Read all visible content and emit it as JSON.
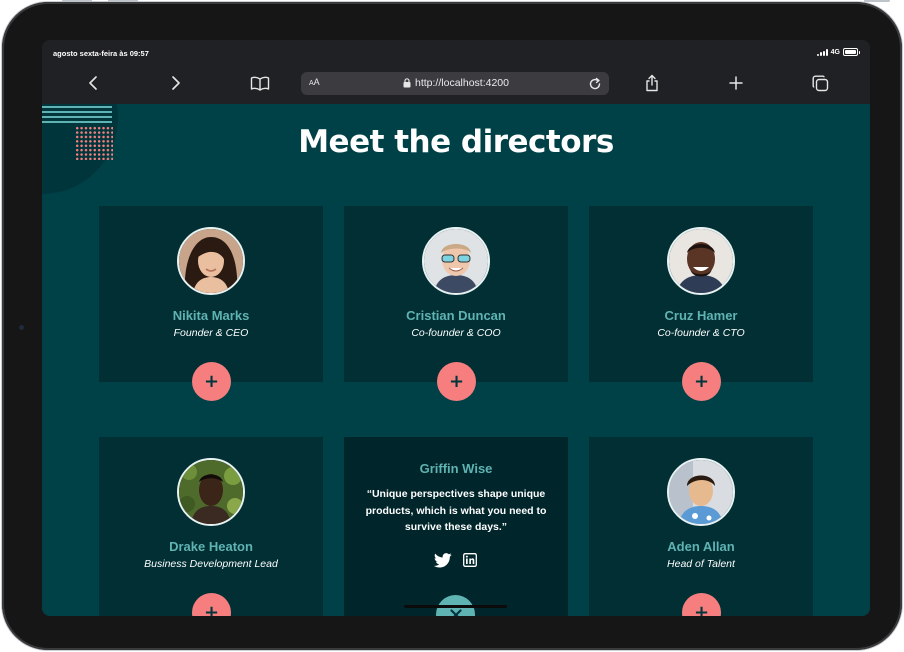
{
  "status_bar": {
    "time": "agosto sexta-feira às 09:57",
    "network": "4G"
  },
  "browser": {
    "text_size_label": "AA",
    "url": "http://localhost:4200"
  },
  "page": {
    "title": "Meet the directors"
  },
  "directors": [
    {
      "name": "Nikita Marks",
      "role": "Founder & CEO"
    },
    {
      "name": "Cristian Duncan",
      "role": "Co-founder & COO"
    },
    {
      "name": "Cruz Hamer",
      "role": "Co-founder & CTO"
    },
    {
      "name": "Drake Heaton",
      "role": "Business Development Lead"
    },
    {
      "name": "Griffin Wise",
      "quote": "“Unique perspectives shape unique products, which is what you need to survive these days.”"
    },
    {
      "name": "Aden Allan",
      "role": "Head of Talent"
    }
  ],
  "buttons": {
    "expand_label": "+"
  },
  "colors": {
    "background": "#004047",
    "card": "#012f34",
    "accent_teal": "#5fb3b3",
    "accent_coral": "#f67e7e"
  },
  "icons": [
    "back-icon",
    "forward-icon",
    "bookmarks-icon",
    "lock-icon",
    "reload-icon",
    "share-icon",
    "new-tab-icon",
    "tabs-icon",
    "twitter-icon",
    "linkedin-icon",
    "close-icon"
  ]
}
